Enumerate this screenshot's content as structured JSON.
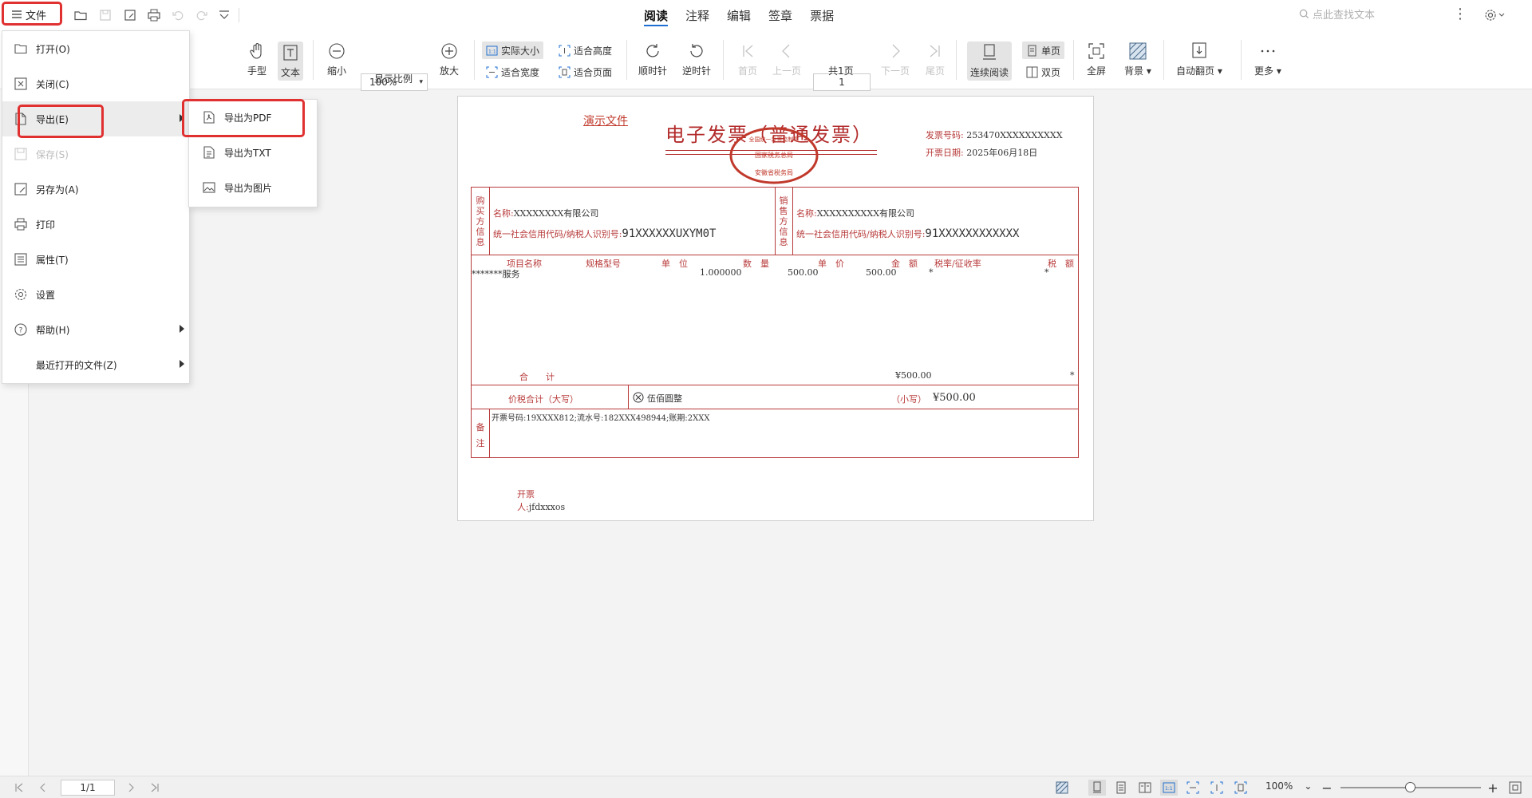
{
  "topbar": {
    "file_label": "文件",
    "tabs": [
      "阅读",
      "注释",
      "编辑",
      "签章",
      "票据"
    ],
    "active_tab": "阅读",
    "search_placeholder": "点此查找文本"
  },
  "ribbon": {
    "hand": "手型",
    "text": "文本",
    "zoom_out": "缩小",
    "zoom_value": "100%",
    "zoom_ratio": "显示比例",
    "zoom_in": "放大",
    "actual_size": "实际大小",
    "fit_height": "适合高度",
    "fit_width": "适合宽度",
    "fit_page": "适合页面",
    "rotate_cw": "顺时针",
    "rotate_ccw": "逆时针",
    "first_page": "首页",
    "prev_page": "上一页",
    "page_value": "1",
    "total_pages": "共1页",
    "next_page": "下一页",
    "last_page": "尾页",
    "continuous": "连续阅读",
    "single": "单页",
    "double": "双页",
    "fullscreen": "全屏",
    "background": "背景",
    "auto_flip": "自动翻页",
    "more": "更多"
  },
  "file_menu": {
    "items": [
      {
        "label": "打开(O)",
        "icon": "folder-icon"
      },
      {
        "label": "关闭(C)",
        "icon": "close-box-icon"
      },
      {
        "label": "导出(E)",
        "icon": "export-icon"
      },
      {
        "label": "保存(S)",
        "icon": "save-icon"
      },
      {
        "label": "另存为(A)",
        "icon": "save-as-icon"
      },
      {
        "label": "打印",
        "icon": "print-icon"
      },
      {
        "label": "属性(T)",
        "icon": "properties-icon"
      },
      {
        "label": "设置",
        "icon": "gear-icon"
      },
      {
        "label": "帮助(H)",
        "icon": "help-icon"
      },
      {
        "label": "最近打开的文件(Z)",
        "icon": ""
      }
    ],
    "export_submenu": [
      {
        "label": "导出为PDF",
        "icon": "pdf-export-icon"
      },
      {
        "label": "导出为TXT",
        "icon": "txt-export-icon"
      },
      {
        "label": "导出为图片",
        "icon": "image-export-icon"
      }
    ]
  },
  "document": {
    "demo_label": "演示文件",
    "title": "电子发票（普通发票）",
    "seal_text_top": "全国统一发票监制章",
    "seal_text_mid": "国家税务总局",
    "seal_text_bottom": "安徽省税务局",
    "invoice_no_label": "发票号码:",
    "invoice_no": "253470XXXXXXXXXX",
    "invoice_date_label": "开票日期:",
    "invoice_date": "2025年06月18日",
    "buyer_vlabel": "购买方信息",
    "seller_vlabel": "销售方信息",
    "buyer_name_label": "名称:",
    "buyer_name": "XXXXXXXX有限公司",
    "buyer_id_label": "统一社会信用代码/纳税人识别号:",
    "buyer_id": "91XXXXXXUXYM0T",
    "seller_name_label": "名称:",
    "seller_name": "XXXXXXXXXX有限公司",
    "seller_id_label": "统一社会信用代码/纳税人识别号:",
    "seller_id": "91XXXXXXXXXXXX",
    "columns": [
      "项目名称",
      "规格型号",
      "单　位",
      "数　量",
      "单　价",
      "金　额",
      "税率/征收率",
      "税　额"
    ],
    "row": {
      "name": "*******服务",
      "qty": "1.000000",
      "price": "500.00",
      "amount": "500.00",
      "rate": "*",
      "tax": "*"
    },
    "total_label": "合　　计",
    "total_amount": "¥500.00",
    "total_tax": "*",
    "tax_total_label": "价税合计（大写）",
    "amount_words": "伍佰圆整",
    "small_label": "（小写）",
    "amount_small": "¥500.00",
    "remark_vlabel": "备注",
    "remark": "开票号码:19XXXX812;流水号:182XXX498944;账期:2XXX",
    "issuer_label": "开票人:",
    "issuer": "jfdxxxos"
  },
  "statusbar": {
    "page_indicator": "1/1",
    "zoom": "100%",
    "zoom_level_fraction": 0.5
  }
}
